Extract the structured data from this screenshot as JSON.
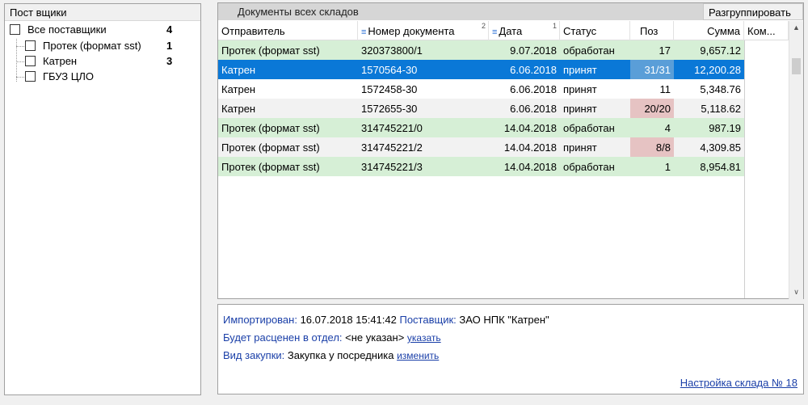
{
  "suppliers": {
    "header": "Пост вщики",
    "items": [
      {
        "label": "Все поставщики",
        "count": "4"
      },
      {
        "label": "Протек (формат sst)",
        "count": "1"
      },
      {
        "label": "Катрен",
        "count": "3"
      },
      {
        "label": "ГБУЗ ЦЛО",
        "count": ""
      }
    ]
  },
  "documents": {
    "title": "Документы  всех складов",
    "regroup_label": "Разгруппировать",
    "columns": {
      "sender": "Отправитель",
      "doc_number": "Номер документа",
      "doc_number_sort": "2",
      "date": "Дата",
      "date_sort": "1",
      "status": "Статус",
      "pos": "Поз",
      "sum": "Сумма",
      "comment": "Ком..."
    },
    "rows": [
      {
        "sender": "Протек (формат sst)",
        "number": "320373800/1",
        "date": "9.07.2018",
        "status": "обработан",
        "pos": "17",
        "sum": "9,657.12"
      },
      {
        "sender": "Катрен",
        "number": "1570564-30",
        "date": "6.06.2018",
        "status": "принят",
        "pos": "31/31",
        "sum": "12,200.28"
      },
      {
        "sender": "Катрен",
        "number": "1572458-30",
        "date": "6.06.2018",
        "status": "принят",
        "pos": "11",
        "sum": "5,348.76"
      },
      {
        "sender": "Катрен",
        "number": "1572655-30",
        "date": "6.06.2018",
        "status": "принят",
        "pos": "20/20",
        "sum": "5,118.62"
      },
      {
        "sender": "Протек (формат sst)",
        "number": "314745221/0",
        "date": "14.04.2018",
        "status": "обработан",
        "pos": "4",
        "sum": "987.19"
      },
      {
        "sender": "Протек (формат sst)",
        "number": "314745221/2",
        "date": "14.04.2018",
        "status": "принят",
        "pos": "8/8",
        "sum": "4,309.85"
      },
      {
        "sender": "Протек (формат sst)",
        "number": "314745221/3",
        "date": "14.04.2018",
        "status": "обработан",
        "pos": "1",
        "sum": "8,954.81"
      }
    ]
  },
  "info": {
    "imported_label": "Импортирован:",
    "imported_value": "16.07.2018 15:41:42",
    "supplier_label": "Поставщик:",
    "supplier_value": "ЗАО НПК \"Катрен\"",
    "dept_label": "Будет расценен в отдел:",
    "dept_value": "<не указан>",
    "dept_link": "указать",
    "purchase_label": "Вид закупки:",
    "purchase_value": "Закупка у посредника",
    "purchase_link": "изменить",
    "settings_link": "Настройка склада № 18"
  },
  "colors": {
    "row_green": "#d6efd6",
    "row_selected": "#0a78d7",
    "pos_pink": "#e6c3c3",
    "link_blue": "#1a3fa8"
  }
}
